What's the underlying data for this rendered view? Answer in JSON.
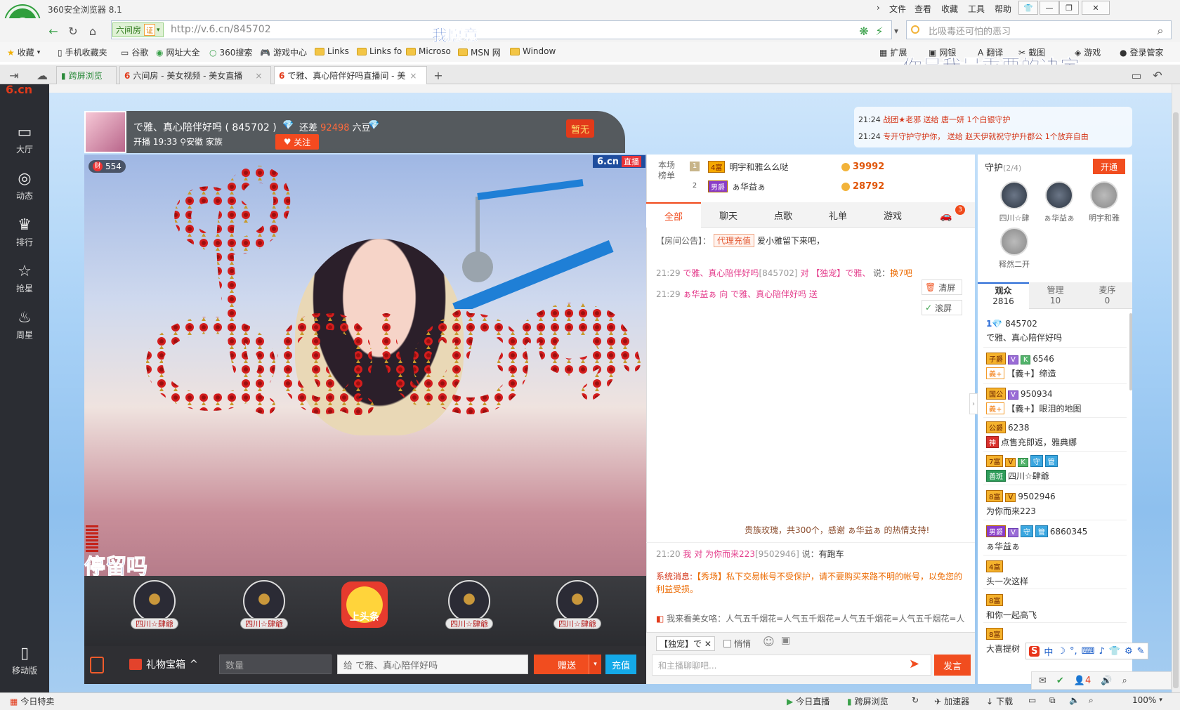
{
  "browser": {
    "app_title": "360安全浏览器 8.1",
    "menu": [
      "文件",
      "查看",
      "收藏",
      "工具",
      "帮助"
    ],
    "site_badge": "六间房",
    "cert_label": "证",
    "url": "http://v.6.cn/845702",
    "overlay_top": "我愿意",
    "search_placeholder": "比吸毒还可怕的恶习",
    "bookmarks": [
      "收藏",
      "手机收藏夹",
      "谷歌",
      "网址大全",
      "360搜索",
      "游戏中心",
      "Links",
      "Links fo",
      "Microso",
      "MSN 网",
      "Window"
    ],
    "bookmarks_right": [
      "扩展",
      "网银",
      "翻译",
      "截图",
      "游戏",
      "登录管家"
    ],
    "overlay_lyric": "你是我最重要的决定",
    "tabs": [
      {
        "label": "跨屏浏览"
      },
      {
        "label": "六间房 - 美女视频 - 美女直播"
      },
      {
        "label": "で雅、真心陪伴好吗直播间 - 美"
      }
    ]
  },
  "leftnav": [
    {
      "label": "大厅",
      "icon": "tv-icon"
    },
    {
      "label": "动态",
      "icon": "compass-icon"
    },
    {
      "label": "排行",
      "icon": "crown-icon"
    },
    {
      "label": "抢星",
      "icon": "star-icon"
    },
    {
      "label": "周星",
      "icon": "gift-cup-icon"
    },
    {
      "label": "移动版",
      "icon": "phone-icon"
    }
  ],
  "streamer": {
    "name": "で雅、真心陪伴好吗 ( 845702 )",
    "gap_prefix": "还差",
    "gap_value": "92498",
    "gap_suffix": "六豆",
    "start_time": "开播 19:33",
    "location": "安徽",
    "family": "家族",
    "follow": "关注",
    "flag": "暂无"
  },
  "video": {
    "viewers": "554",
    "brand": "6.cn",
    "live": "直播",
    "caption": "停留吗"
  },
  "guards_bar": [
    {
      "plate": "四川☆肆爺"
    },
    {
      "plate": "四川☆肆爺"
    },
    {
      "plate": "上头条"
    },
    {
      "plate": "四川☆肆爺"
    },
    {
      "plate": "四川☆肆爺"
    }
  ],
  "giftbar": {
    "gift_box": "礼物宝箱",
    "qty_placeholder": "数量",
    "to": "给",
    "to_name": "で雅、真心陪伴好吗",
    "send": "赠送",
    "recharge": "充值"
  },
  "ticker": [
    {
      "time": "21:24",
      "text": "战团★老邪 送给 唐一妍 1个白银守护"
    },
    {
      "time": "21:24",
      "text": "专开守护守护你， 送给 赵天伊就祝守护升郡公 1个放弃自由"
    }
  ],
  "rank": {
    "label": "本场榜单",
    "rows": [
      {
        "num": "1",
        "level": "4富",
        "name": "明宇和雅么么哒",
        "score": "39992"
      },
      {
        "num": "2",
        "level": "男爵",
        "name": "ぁ华益ぁ",
        "score": "28792"
      }
    ]
  },
  "chat_tabs": [
    "全部",
    "聊天",
    "点歌",
    "礼单",
    "游戏"
  ],
  "car_count": "3",
  "chat": {
    "notice_label": "【房间公告】：",
    "notice_agent": "代理充值",
    "notice_text": "爱小雅留下来吧，",
    "m1_time": "21:29",
    "m1_from": "で雅、真心陪伴好吗",
    "m1_id": "[845702]",
    "m1_to": "对 【独宠】で雅、",
    "m1_say": "说：",
    "m1_text": "换7吧",
    "m2_time": "21:29",
    "m2_from": "ぁ华益ぁ",
    "m2_to": "向 で雅、真心陪伴好吗 送",
    "clear": "清屏",
    "scroll": "滚屏",
    "rose_text": "贵族玫瑰，共300个，感谢 ぁ华益ぁ 的热情支持!",
    "m3_time": "21:20",
    "m3_from": "我 对 为你而来223",
    "m3_id": "[9502946]",
    "m3_say": "说：",
    "m3_text": "有跑车",
    "system_label": "系统消息:",
    "system_text": "【秀场】私下交易帐号不受保护，请不要购买来路不明的帐号，以免您的利益受损。",
    "promo": "我来看美女咯：人气五千烟花=人气五千烟花=人气五千烟花=人气五千烟花=人气五千烟花"
  },
  "chat_input": {
    "exclusive": "【独宠】で",
    "whisper": "悄悄",
    "placeholder": "和主播聊聊吧...",
    "send": "发言"
  },
  "guards": {
    "title": "守护",
    "count": "(2/4)",
    "open": "开通",
    "members": [
      "四川☆肆",
      "ぁ华益ぁ",
      "明宇和雅",
      "释然二开"
    ]
  },
  "audience_tabs": [
    {
      "label": "观众",
      "count": "2816"
    },
    {
      "label": "管理",
      "count": "10"
    },
    {
      "label": "麦序",
      "count": "0"
    }
  ],
  "audience": [
    {
      "id": "845702",
      "name": "で雅、真心陪伴好吗"
    },
    {
      "id": "6546",
      "name": "【義+】缔造"
    },
    {
      "id": "950934",
      "name": "【義+】眼泪的地图"
    },
    {
      "id": "6238",
      "name": "点售充即返，雅典娜"
    },
    {
      "id": "",
      "name": "四川☆肆爺"
    },
    {
      "id": "9502946",
      "name": "为你而来223"
    },
    {
      "id": "6860345",
      "name": "ぁ华益ぁ"
    },
    {
      "id": "",
      "name": "头一次这样"
    },
    {
      "id": "",
      "name": "和你一起高飞"
    },
    {
      "id": "",
      "name": "大喜提树"
    }
  ],
  "ime": {
    "s": "S",
    "items": [
      "中",
      "☽",
      "°,",
      "⌨",
      "♪",
      "👕",
      "⚙",
      "✎"
    ]
  },
  "util": {
    "count": "4"
  },
  "status": {
    "left": "今日特卖",
    "items": [
      "今日直播",
      "跨屏浏览",
      "加速器",
      "下载"
    ],
    "zoom": "100%"
  }
}
